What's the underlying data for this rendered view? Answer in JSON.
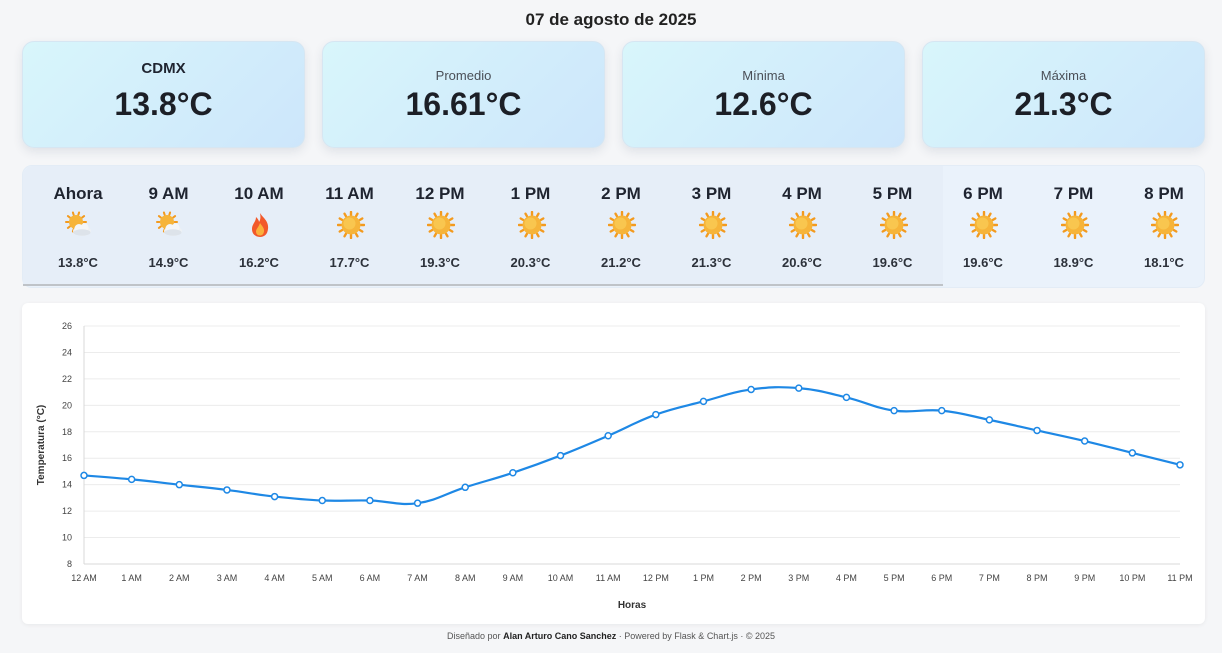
{
  "date_title": "07 de agosto de 2025",
  "cards": [
    {
      "label": "CDMX",
      "value": "13.8°C"
    },
    {
      "label": "Promedio",
      "value": "16.61°C"
    },
    {
      "label": "Mínima",
      "value": "12.6°C"
    },
    {
      "label": "Máxima",
      "value": "21.3°C"
    }
  ],
  "hourly": [
    {
      "label": "Ahora",
      "icon": "partly-cloudy-icon",
      "temp": "13.8°C"
    },
    {
      "label": "9 AM",
      "icon": "partly-cloudy-icon",
      "temp": "14.9°C"
    },
    {
      "label": "10 AM",
      "icon": "fire-icon",
      "temp": "16.2°C"
    },
    {
      "label": "11 AM",
      "icon": "sun-icon",
      "temp": "17.7°C"
    },
    {
      "label": "12 PM",
      "icon": "sun-icon",
      "temp": "19.3°C"
    },
    {
      "label": "1 PM",
      "icon": "sun-icon",
      "temp": "20.3°C"
    },
    {
      "label": "2 PM",
      "icon": "sun-icon",
      "temp": "21.2°C"
    },
    {
      "label": "3 PM",
      "icon": "sun-icon",
      "temp": "21.3°C"
    },
    {
      "label": "4 PM",
      "icon": "sun-icon",
      "temp": "20.6°C"
    },
    {
      "label": "5 PM",
      "icon": "sun-icon",
      "temp": "19.6°C"
    },
    {
      "label": "6 PM",
      "icon": "sun-icon",
      "temp": "19.6°C"
    },
    {
      "label": "7 PM",
      "icon": "sun-icon",
      "temp": "18.9°C"
    },
    {
      "label": "8 PM",
      "icon": "sun-icon",
      "temp": "18.1°C"
    }
  ],
  "chart_data": {
    "type": "line",
    "categories": [
      "12 AM",
      "1 AM",
      "2 AM",
      "3 AM",
      "4 AM",
      "5 AM",
      "6 AM",
      "7 AM",
      "8 AM",
      "9 AM",
      "10 AM",
      "11 AM",
      "12 PM",
      "1 PM",
      "2 PM",
      "3 PM",
      "4 PM",
      "5 PM",
      "6 PM",
      "7 PM",
      "8 PM",
      "9 PM",
      "10 PM",
      "11 PM"
    ],
    "series": [
      {
        "values": [
          14.7,
          14.4,
          14.0,
          13.6,
          13.1,
          12.8,
          12.8,
          12.6,
          13.8,
          14.9,
          16.2,
          17.7,
          19.3,
          20.3,
          21.2,
          21.3,
          20.6,
          19.6,
          19.6,
          18.9,
          18.1,
          17.3,
          16.4,
          15.5
        ]
      }
    ],
    "xlabel": "Horas",
    "ylabel": "Temperatura (°C)",
    "ylim": [
      8,
      26
    ],
    "yticks": [
      8,
      10,
      12,
      14,
      16,
      18,
      20,
      22,
      24,
      26
    ],
    "grid": true,
    "line_color": "#1e88e5"
  },
  "footer": {
    "prefix": "Diseñado por",
    "author": "Alan Arturo Cano Sanchez",
    "suffix": "· Powered by Flask & Chart.js · © 2025"
  }
}
